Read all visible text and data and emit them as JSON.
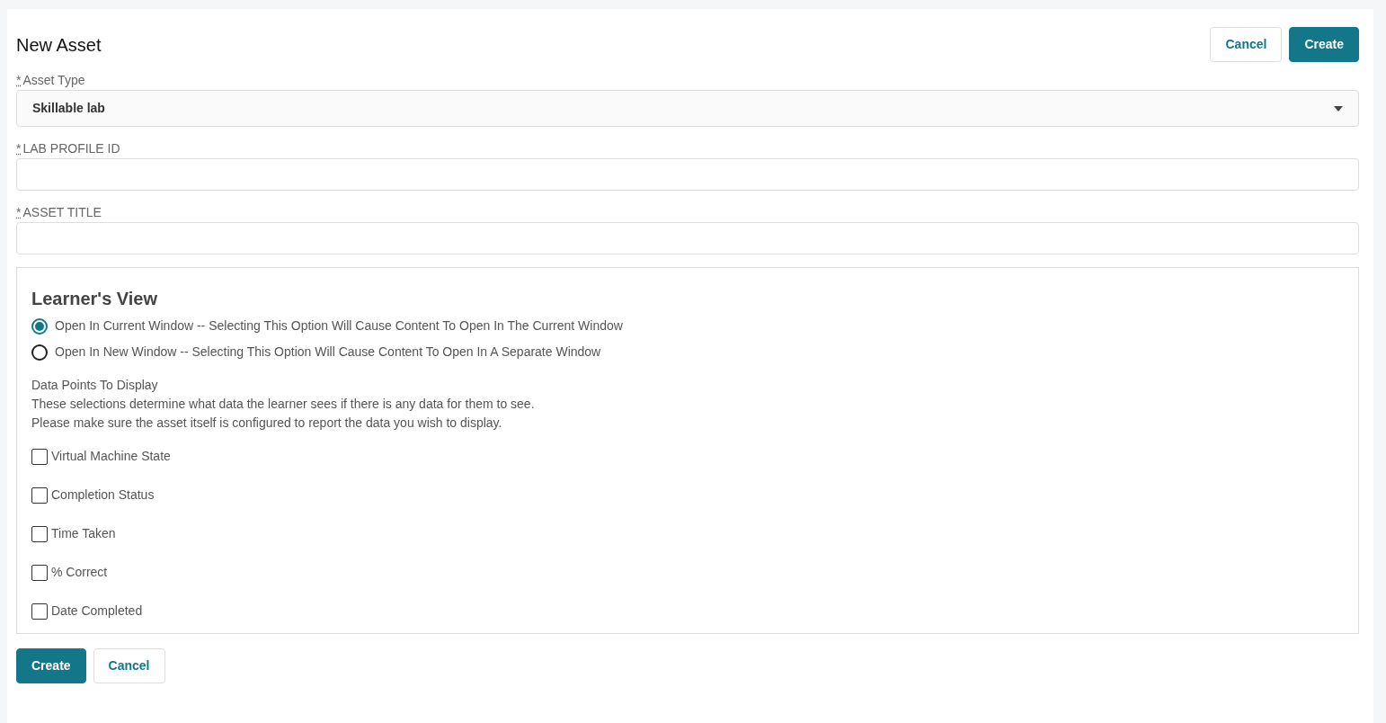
{
  "page_title": "New Asset",
  "header_buttons": [
    {
      "label": "Cancel",
      "kind": "secondary"
    },
    {
      "label": "Create",
      "kind": "primary"
    }
  ],
  "fields": [
    {
      "required_mark": "*",
      "label": "Asset Type",
      "kind": "select",
      "value": "Skillable lab"
    },
    {
      "required_mark": "*",
      "label": "LAB PROFILE ID",
      "kind": "text"
    },
    {
      "required_mark": "*",
      "label": "ASSET TITLE",
      "kind": "text"
    }
  ],
  "learners_view": {
    "heading": "Learner's View",
    "options": [
      {
        "label": "Open In Current Window -- Selecting This Option Will Cause Content To Open In The Current Window",
        "selected": true
      },
      {
        "label": "Open In New Window -- Selecting This Option Will Cause Content To Open In A Separate Window",
        "selected": false
      }
    ],
    "data_points_title": "Data Points To Display",
    "description_lines": [
      "These selections determine what data the learner sees if there is any data for them to see.",
      "Please make sure the asset itself is configured to report the data you wish to display."
    ],
    "checkboxes": [
      {
        "label": "Virtual Machine State",
        "checked": false
      },
      {
        "label": "Completion Status",
        "checked": false
      },
      {
        "label": "Time Taken",
        "checked": false
      },
      {
        "label": "% Correct",
        "checked": false
      },
      {
        "label": "Date Completed",
        "checked": false
      }
    ]
  },
  "footer_buttons": [
    {
      "label": "Create",
      "kind": "primary"
    },
    {
      "label": "Cancel",
      "kind": "secondary"
    }
  ]
}
